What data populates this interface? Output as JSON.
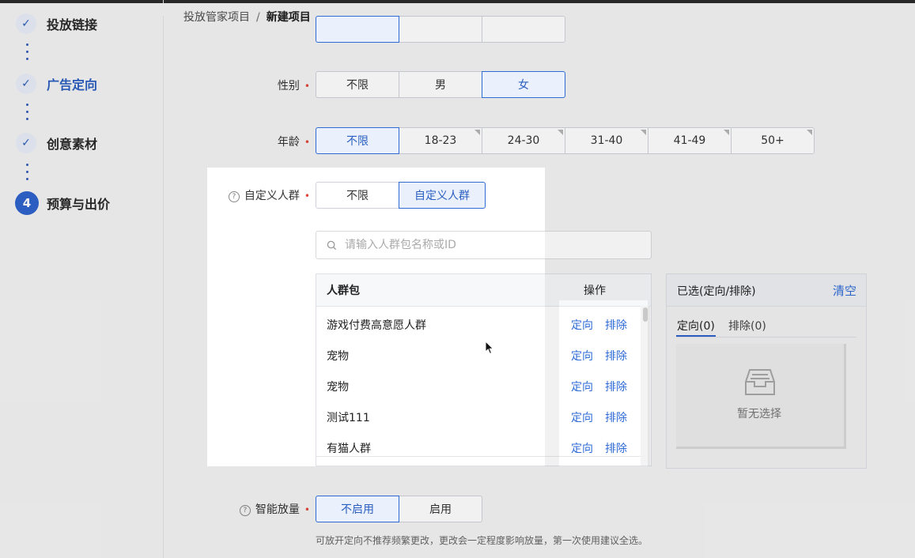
{
  "breadcrumb": {
    "parent": "投放管家项目",
    "separator": "/",
    "current": "新建项目"
  },
  "steps": [
    {
      "label": "投放链接",
      "state": "done",
      "icon": "check-icon"
    },
    {
      "label": "广告定向",
      "state": "done-current",
      "icon": "check-icon"
    },
    {
      "label": "创意素材",
      "state": "done",
      "icon": "check-icon"
    },
    {
      "label": "预算与出价",
      "state": "active",
      "number": "4"
    }
  ],
  "gender": {
    "label": "性别",
    "options": [
      "不限",
      "男",
      "女"
    ],
    "selected": "女"
  },
  "age": {
    "label": "年龄",
    "options": [
      "不限",
      "18-23",
      "24-30",
      "31-40",
      "41-49",
      "50+"
    ],
    "selected": "不限"
  },
  "custom_audience": {
    "label": "自定义人群",
    "options": [
      "不限",
      "自定义人群"
    ],
    "selected": "自定义人群",
    "search_placeholder": "请输入人群包名称或ID",
    "table": {
      "col_name": "人群包",
      "col_action": "操作",
      "action_target": "定向",
      "action_exclude": "排除",
      "rows": [
        "游戏付费高意愿人群",
        "宠物",
        "宠物",
        "测试111",
        "有猫人群"
      ]
    },
    "selected_panel": {
      "title": "已选(定向/排除)",
      "clear": "清空",
      "tab_target": "定向(0)",
      "tab_exclude": "排除(0)",
      "empty_text": "暂无选择"
    }
  },
  "smart_expand": {
    "label": "智能放量",
    "options": [
      "不启用",
      "启用"
    ],
    "selected": "不启用",
    "hint": "可放开定向不推荐频繁更改，更改会一定程度影响放量，第一次使用建议全选。"
  },
  "colors": {
    "accent": "#2f63cc",
    "required": "#e0453b"
  }
}
